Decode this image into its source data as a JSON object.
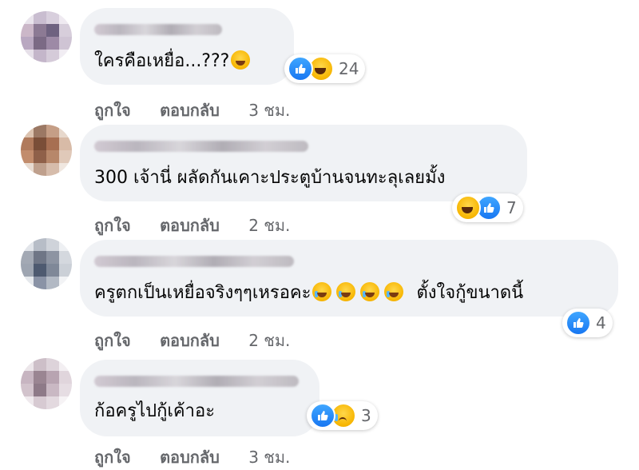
{
  "comments": [
    {
      "text": "ใครคือเหยื่อ...???",
      "reaction_count": "24",
      "actions": {
        "like": "ถูกใจ",
        "reply": "ตอบกลับ",
        "time": "3 ชม."
      }
    },
    {
      "text": "300 เจ้านี่ ผลัดกันเคาะประตูบ้านจนทะลุเลยมั้ง",
      "reaction_count": "7",
      "actions": {
        "like": "ถูกใจ",
        "reply": "ตอบกลับ",
        "time": "2 ชม."
      }
    },
    {
      "text": "ครูตกเป็นเหยื่อจริงๆๆเหรอคะ",
      "text_after": "ตั้งใจกู้ขนาดนี้",
      "reaction_count": "4",
      "actions": {
        "like": "ถูกใจ",
        "reply": "ตอบกลับ",
        "time": "2 ชม."
      }
    },
    {
      "text": "ก้อครูไปกู้เค้าอะ",
      "reaction_count": "3",
      "actions": {
        "like": "ถูกใจ",
        "reply": "ตอบกลับ",
        "time": "3 ชม."
      }
    }
  ],
  "colors": {
    "bubble": "#f0f2f5",
    "meta": "#65676b",
    "like_blue": "#1877f2",
    "emoji_yellow": "#f7b500"
  },
  "icons": [
    "like-reaction-icon",
    "haha-reaction-icon",
    "sad-reaction-icon",
    "crying-emoji-icon",
    "laughing-emoji-icon"
  ]
}
